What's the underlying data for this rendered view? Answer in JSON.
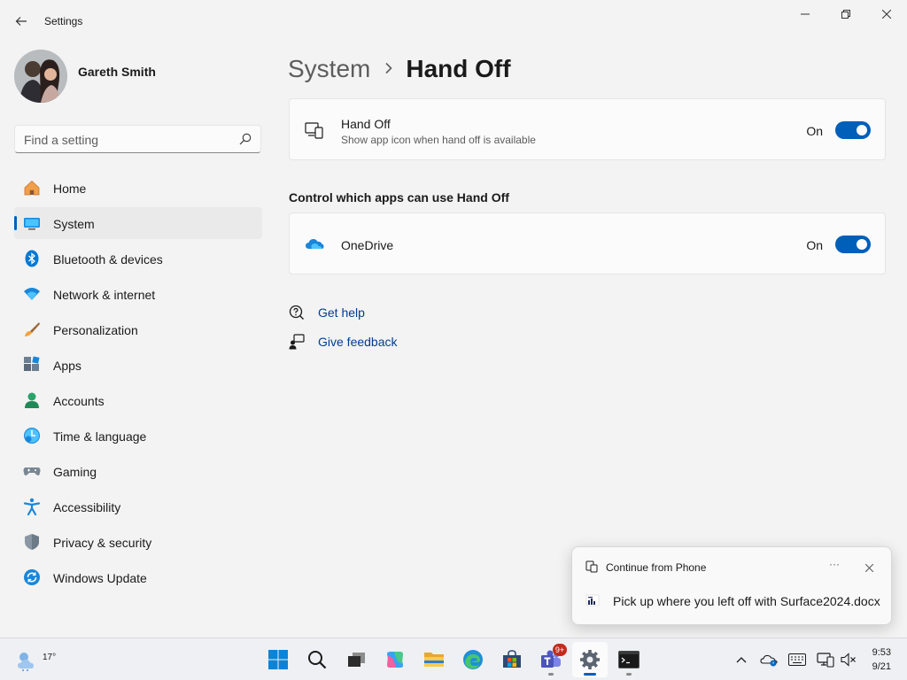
{
  "window": {
    "title": "Settings"
  },
  "profile": {
    "name": "Gareth Smith"
  },
  "search": {
    "placeholder": "Find a setting"
  },
  "sidebar": {
    "items": [
      {
        "label": "Home",
        "icon": "home-icon"
      },
      {
        "label": "System",
        "icon": "system-icon",
        "selected": true
      },
      {
        "label": "Bluetooth & devices",
        "icon": "bluetooth-icon"
      },
      {
        "label": "Network & internet",
        "icon": "wifi-icon"
      },
      {
        "label": "Personalization",
        "icon": "brush-icon"
      },
      {
        "label": "Apps",
        "icon": "apps-icon"
      },
      {
        "label": "Accounts",
        "icon": "accounts-icon"
      },
      {
        "label": "Time & language",
        "icon": "clock-globe-icon"
      },
      {
        "label": "Gaming",
        "icon": "gamepad-icon"
      },
      {
        "label": "Accessibility",
        "icon": "accessibility-icon"
      },
      {
        "label": "Privacy & security",
        "icon": "shield-icon"
      },
      {
        "label": "Windows Update",
        "icon": "update-icon"
      }
    ]
  },
  "breadcrumb": {
    "parent": "System",
    "separator": ">",
    "current": "Hand Off"
  },
  "handoff_card": {
    "title": "Hand Off",
    "subtitle": "Show app icon when hand off is available",
    "toggle_label": "On",
    "toggle_on": true
  },
  "apps_section": {
    "heading": "Control which apps can use Hand Off",
    "apps": [
      {
        "name": "OneDrive",
        "toggle_label": "On",
        "toggle_on": true
      }
    ]
  },
  "help": {
    "get_help": "Get help",
    "give_feedback": "Give feedback"
  },
  "toast": {
    "title": "Continue from Phone",
    "more": "···",
    "body": "Pick up where you left off with Surface2024.docx"
  },
  "taskbar": {
    "weather_temp": "17°",
    "teams_badge": "9+",
    "time": "9:53",
    "date": "9/21",
    "apps": [
      "start-icon",
      "search-icon",
      "task-view-icon",
      "copilot-icon",
      "file-explorer-icon",
      "edge-icon",
      "store-icon",
      "teams-icon",
      "settings-icon",
      "terminal-icon"
    ]
  },
  "colors": {
    "accent": "#005fb8",
    "link": "#003e92",
    "background": "#f3f3f3",
    "card": "#fbfbfb"
  }
}
